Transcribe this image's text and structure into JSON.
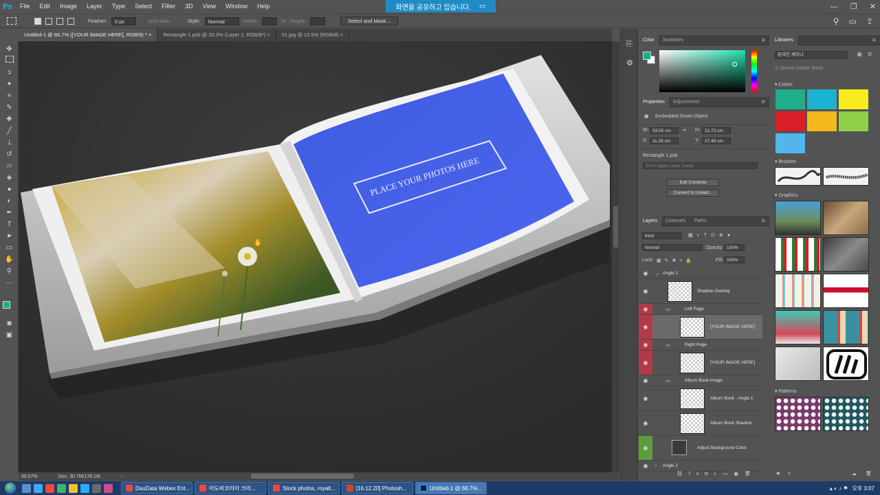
{
  "app": {
    "logo": "Ps"
  },
  "menu": [
    "File",
    "Edit",
    "Image",
    "Layer",
    "Type",
    "Select",
    "Filter",
    "3D",
    "View",
    "Window",
    "Help"
  ],
  "share_banner": "화면을 공유하고 있습니다.",
  "window_controls": {
    "minimize": "—",
    "restore": "❐",
    "close": "✕"
  },
  "options": {
    "feather_label": "Feather:",
    "feather_value": "0 px",
    "antialias_label": "Anti-alias",
    "style_label": "Style:",
    "style_value": "Normal",
    "width_label": "Width:",
    "height_label": "Height:",
    "select_mask_button": "Select and Mask..."
  },
  "tabs": [
    "Untitled-1 @ 66.7% ([YOUR IMAGE HERE], RGB/8) * ×",
    "Rectangle 1.psb @ 33.3% (Layer 1, RGB/8*) ×",
    "01.jpg @ 12.5% (RGB/8) ×"
  ],
  "canvas": {
    "page_text": "PLACE YOUR PHOTOS HERE"
  },
  "status": {
    "zoom": "66.67%",
    "doc": "Doc: 30.7M/178.1M"
  },
  "color_panel": {
    "tabs": [
      "Color",
      "Swatches"
    ],
    "foreground": "#1fae8a"
  },
  "properties": {
    "tabs": [
      "Properties",
      "Adjustments"
    ],
    "object_type": "Embedded Smart Object",
    "w_label": "W:",
    "w_value": "33.55 cm",
    "h_label": "H:",
    "h_value": "21.73 cm",
    "x_label": "X:",
    "x_value": "11.28 cm",
    "y_label": "Y:",
    "y_value": "27.48 cm",
    "file": "Rectangle 1.psb",
    "layer_comp": "Don't Apply Layer Comp",
    "edit_contents": "Edit Contents",
    "convert_linked": "Convert to Linked..."
  },
  "layers_panel": {
    "tabs": [
      "Layers",
      "Channels",
      "Paths"
    ],
    "kind_label": "Kind",
    "blend_mode": "Normal",
    "opacity_label": "Opacity:",
    "opacity_value": "100%",
    "lock_label": "Lock:",
    "fill_label": "Fill:",
    "fill_value": "100%",
    "layers": [
      {
        "name": "Angle 1"
      },
      {
        "name": "Shadow Overlay"
      },
      {
        "name": "Left Page"
      },
      {
        "name": "[YOUR IMAGE HERE]"
      },
      {
        "name": "Right Page"
      },
      {
        "name": "[YOUR IMAGE HERE]"
      },
      {
        "name": "Album Book Image"
      },
      {
        "name": "Album Book - Angle 1"
      },
      {
        "name": "Album Book Shadow"
      },
      {
        "name": "Adjust Background Color"
      },
      {
        "name": "Angle 2"
      }
    ]
  },
  "libraries": {
    "title": "Libraries",
    "library_name": "온라인 세미나",
    "search_placeholder": "Search Adobe Stock",
    "sections": [
      "Colors",
      "Brushes",
      "Graphics",
      "Patterns"
    ],
    "colors": [
      "#1fae8a",
      "#1ab2d0",
      "#f8ec1c",
      "#d61f26",
      "#f4b81c",
      "#8fd04a",
      "#52b6ea"
    ]
  },
  "taskbar": {
    "items": [
      "DauData Webex Ent...",
      "어도비코리아 크리...",
      "Stock photos, royalt...",
      "[16.12.20] Photosh...",
      "Untitled-1 @ 66.7%..."
    ],
    "time": "오후 3:07"
  }
}
